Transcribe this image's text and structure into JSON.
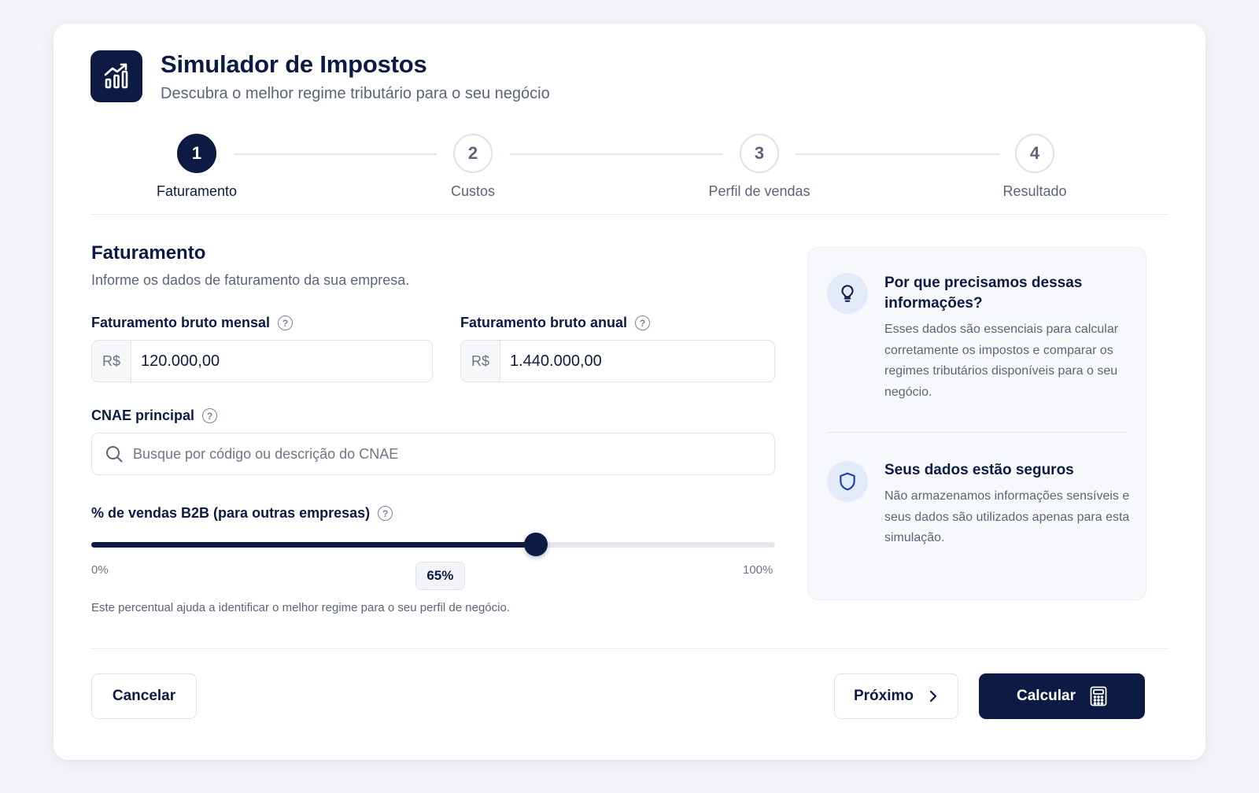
{
  "header": {
    "title": "Simulador de Impostos",
    "subtitle": "Descubra o melhor regime tributário para o seu negócio",
    "logo_icon": "chart-growth-icon"
  },
  "stepper": {
    "active_step": 1,
    "steps": [
      {
        "number": "1",
        "label": "Faturamento"
      },
      {
        "number": "2",
        "label": "Custos"
      },
      {
        "number": "3",
        "label": "Perfil de vendas"
      },
      {
        "number": "4",
        "label": "Resultado"
      }
    ]
  },
  "form": {
    "title": "Faturamento",
    "description": "Informe os dados de faturamento da sua empresa.",
    "monthly": {
      "label": "Faturamento bruto mensal",
      "prefix": "R$",
      "value": "120.000,00"
    },
    "annual": {
      "label": "Faturamento bruto anual",
      "prefix": "R$",
      "value": "1.440.000,00"
    },
    "cnae": {
      "label": "CNAE principal",
      "placeholder": "Busque por código ou descrição do CNAE"
    },
    "b2b": {
      "label": "% de vendas B2B (para outras empresas)",
      "value": 65,
      "value_label": "65%",
      "min_label": "0%",
      "max_label": "100%",
      "hint": "Este percentual ajuda a identificar o melhor regime para o seu perfil de negócio."
    }
  },
  "info": {
    "why": {
      "title": "Por que precisamos dessas informações?",
      "text": "Esses dados são essenciais para calcular corretamente os impostos e comparar os regimes tributários disponíveis para o seu negócio.",
      "icon": "lightbulb-icon"
    },
    "secure": {
      "title": "Seus dados estão seguros",
      "text": "Não armazenamos informações sensíveis e seus dados são utilizados apenas para esta simulação.",
      "icon": "shield-icon"
    }
  },
  "footer": {
    "cancel_label": "Cancelar",
    "next_label": "Próximo",
    "calculate_label": "Calcular"
  },
  "colors": {
    "primary": "#0c1a44",
    "accent_light": "#e3ebf8",
    "text_muted": "#5c6478",
    "border": "#dfe2e9"
  }
}
